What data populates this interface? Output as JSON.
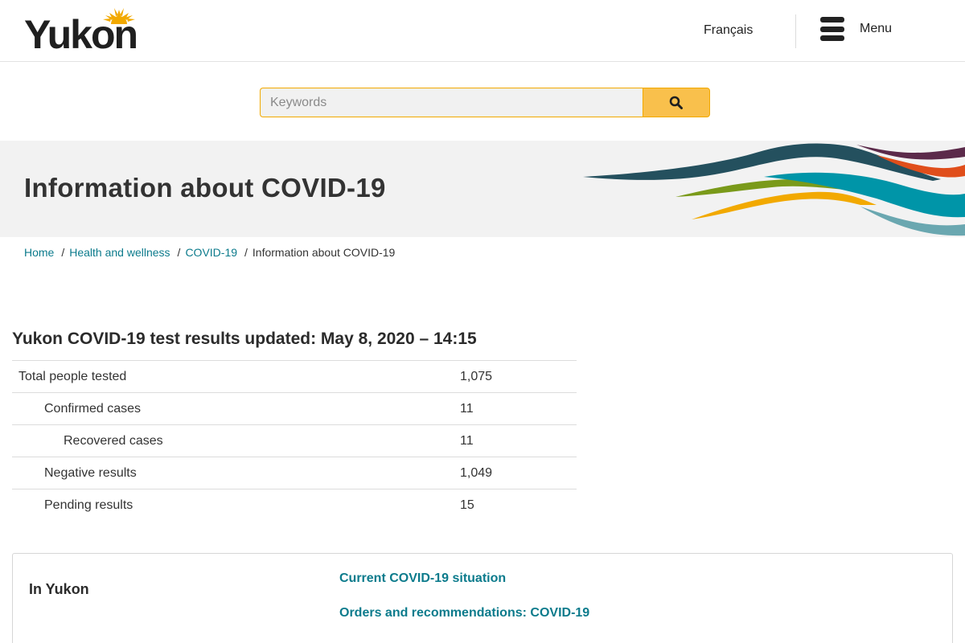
{
  "header": {
    "logo_text": "Yukon",
    "language_link": "Français",
    "menu_label": "Menu"
  },
  "search": {
    "placeholder": "Keywords"
  },
  "banner": {
    "title": "Information about COVID-19"
  },
  "breadcrumb": {
    "items": [
      "Home",
      "Health and wellness",
      "COVID-19"
    ],
    "current": "Information about COVID-19",
    "separator": "/"
  },
  "results": {
    "heading": "Yukon COVID-19 test results updated: May 8, 2020 – 14:15",
    "rows": [
      {
        "label": "Total people tested",
        "value": "1,075"
      },
      {
        "label": "Confirmed cases",
        "value": "11"
      },
      {
        "label": "Recovered cases",
        "value": "11"
      },
      {
        "label": "Negative results",
        "value": "1,049"
      },
      {
        "label": "Pending results",
        "value": "15"
      }
    ]
  },
  "links_box": {
    "label": "In Yukon",
    "links": [
      "Current COVID-19 situation",
      "Orders and recommendations: COVID-19"
    ]
  },
  "colors": {
    "link": "#0c7b8c",
    "search_button": "#f9c04c",
    "banner_bg": "#f2f2f2"
  },
  "icons": [
    "sun-logo-icon",
    "hamburger-menu-icon",
    "search-icon"
  ]
}
